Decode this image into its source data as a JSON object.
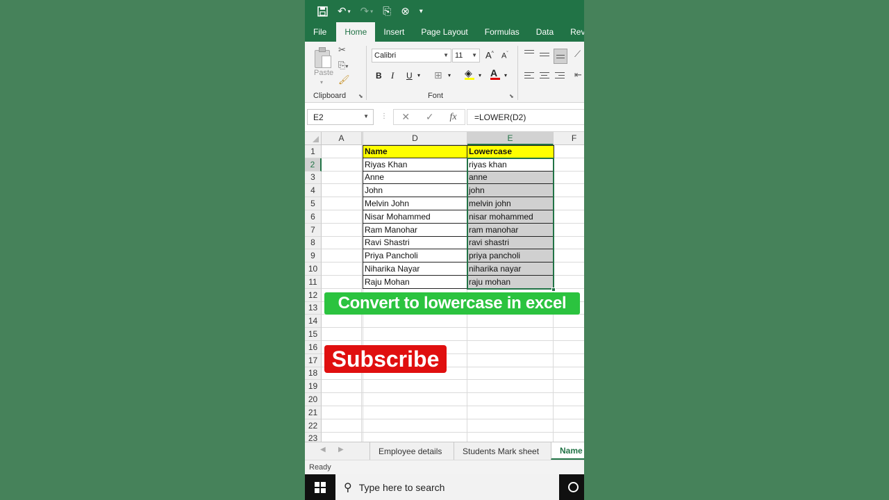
{
  "quick_access": {
    "icons": [
      "save-icon",
      "undo-icon",
      "redo-icon",
      "touch-mode-icon",
      "customize-icon"
    ]
  },
  "ribbon_tabs": [
    "File",
    "Home",
    "Insert",
    "Page Layout",
    "Formulas",
    "Data",
    "Revi"
  ],
  "ribbon": {
    "paste_label": "Paste",
    "clipboard_label": "Clipboard",
    "font_label": "Font",
    "font_name": "Calibri",
    "font_size": "11",
    "grow_font": "A",
    "shrink_font": "A",
    "bold": "B",
    "italic": "I",
    "underline": "U"
  },
  "formula_bar": {
    "name_box": "E2",
    "fx_label": "fx",
    "cancel": "✕",
    "enter": "✓",
    "formula": "=LOWER(D2)"
  },
  "columns": [
    "A",
    "D",
    "E",
    "F"
  ],
  "rows": [
    {
      "num": "1",
      "name": "Name",
      "lower": "Lowercase"
    },
    {
      "num": "2",
      "name": "Riyas Khan",
      "lower": "riyas khan"
    },
    {
      "num": "3",
      "name": "Anne",
      "lower": "anne"
    },
    {
      "num": "4",
      "name": "John",
      "lower": "john"
    },
    {
      "num": "5",
      "name": "Melvin John",
      "lower": "melvin john"
    },
    {
      "num": "6",
      "name": "Nisar Mohammed",
      "lower": "nisar mohammed"
    },
    {
      "num": "7",
      "name": "Ram Manohar",
      "lower": "ram manohar"
    },
    {
      "num": "8",
      "name": "Ravi Shastri",
      "lower": "ravi shastri"
    },
    {
      "num": "9",
      "name": "Priya Pancholi",
      "lower": "priya pancholi"
    },
    {
      "num": "10",
      "name": "Niharika Nayar",
      "lower": "niharika nayar"
    },
    {
      "num": "11",
      "name": "Raju Mohan",
      "lower": "raju mohan"
    }
  ],
  "empty_rows": [
    "12",
    "13",
    "14",
    "15",
    "16",
    "17",
    "18",
    "19",
    "20",
    "21",
    "22",
    "23"
  ],
  "overlay": {
    "title": "Convert to lowercase in excel",
    "subscribe": "Subscribe"
  },
  "sheet_tabs": [
    "Employee details",
    "Students Mark sheet",
    "Name"
  ],
  "status": "Ready",
  "taskbar": {
    "search_placeholder": "Type here to search"
  },
  "colors": {
    "excel_green": "#217346",
    "header_yellow": "#ffff00",
    "banner_green": "#2bc33f",
    "subscribe_red": "#e00f0f"
  }
}
